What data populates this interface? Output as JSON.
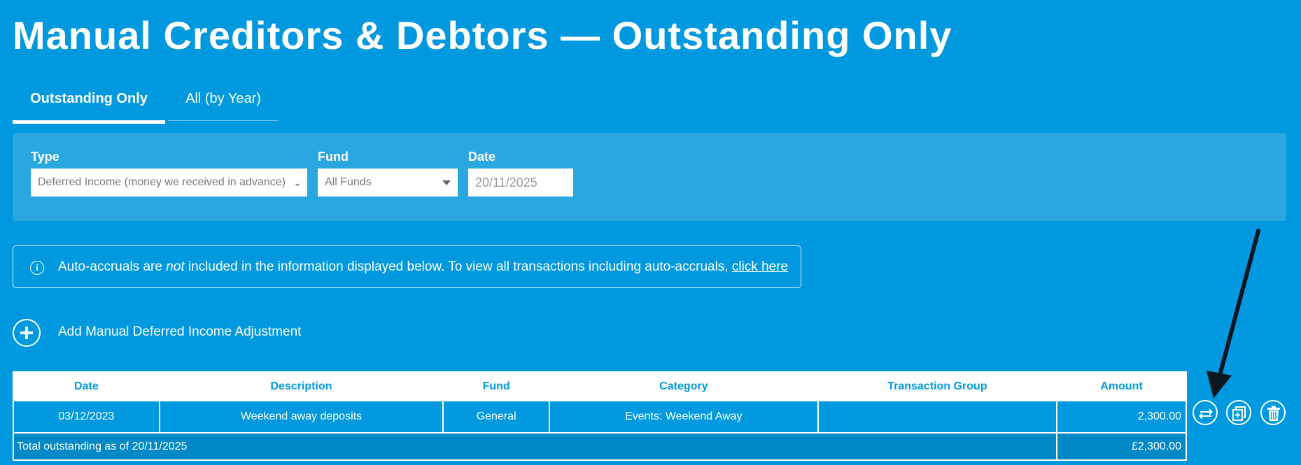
{
  "page": {
    "title": "Manual Creditors & Debtors — Outstanding Only"
  },
  "tabs": [
    {
      "label": "Outstanding Only",
      "active": true
    },
    {
      "label": "All (by Year)",
      "active": false
    }
  ],
  "filters": {
    "type_label": "Type",
    "type_value": "Deferred Income (money we received in advance)",
    "fund_label": "Fund",
    "fund_value": "All Funds",
    "date_label": "Date",
    "date_value": "20/11/2025"
  },
  "info": {
    "text_before": "Auto-accruals are ",
    "text_em": "not",
    "text_after": " included in the information displayed below. To view all transactions including auto-accruals, ",
    "link": "click here"
  },
  "add_action": {
    "label": "Add Manual Deferred Income Adjustment"
  },
  "table": {
    "headers": [
      "Date",
      "Description",
      "Fund",
      "Category",
      "Transaction Group",
      "Amount"
    ],
    "rows": [
      {
        "date": "03/12/2023",
        "description": "Weekend away deposits",
        "fund": "General",
        "category": "Events: Weekend Away",
        "group": "",
        "amount": "2,300.00"
      }
    ],
    "total_label": "Total outstanding as of 20/11/2025",
    "total_amount": "£2,300.00"
  },
  "row_actions": [
    "transfer-icon",
    "copy-icon",
    "delete-icon"
  ],
  "colors": {
    "background": "#0099e0",
    "panel": "#2aa7e0",
    "total_row": "#0088c7"
  }
}
